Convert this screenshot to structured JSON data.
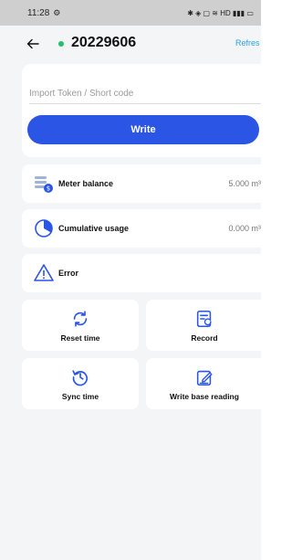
{
  "status_bar": {
    "time": "11:28",
    "indicators": "✱ ◈ ▢ ≋ HD ▮▮▮ ▭"
  },
  "header": {
    "meter_id": "20229606",
    "refresh_label": "Refres",
    "status_color": "#24c06c"
  },
  "token": {
    "placeholder": "Import Token / Short code",
    "value": "",
    "write_label": "Write",
    "button_color": "#2a55e5"
  },
  "rows": {
    "meter_balance": {
      "label": "Meter balance",
      "value": "5.000 m³"
    },
    "cumulative_usage": {
      "label": "Cumulative usage",
      "value": "0.000 m³"
    },
    "error": {
      "label": "Error"
    }
  },
  "actions": {
    "reset_time": "Reset time",
    "record": "Record",
    "sync_time": "Sync time",
    "write_base_reading": "Write base reading"
  },
  "icons": {
    "back": "arrow-left-icon",
    "balance": "coins-icon",
    "usage": "pie-chart-icon",
    "error": "warning-triangle-icon",
    "reset": "refresh-icon",
    "record": "document-icon",
    "sync": "clock-rotate-icon",
    "write_base": "edit-icon"
  }
}
